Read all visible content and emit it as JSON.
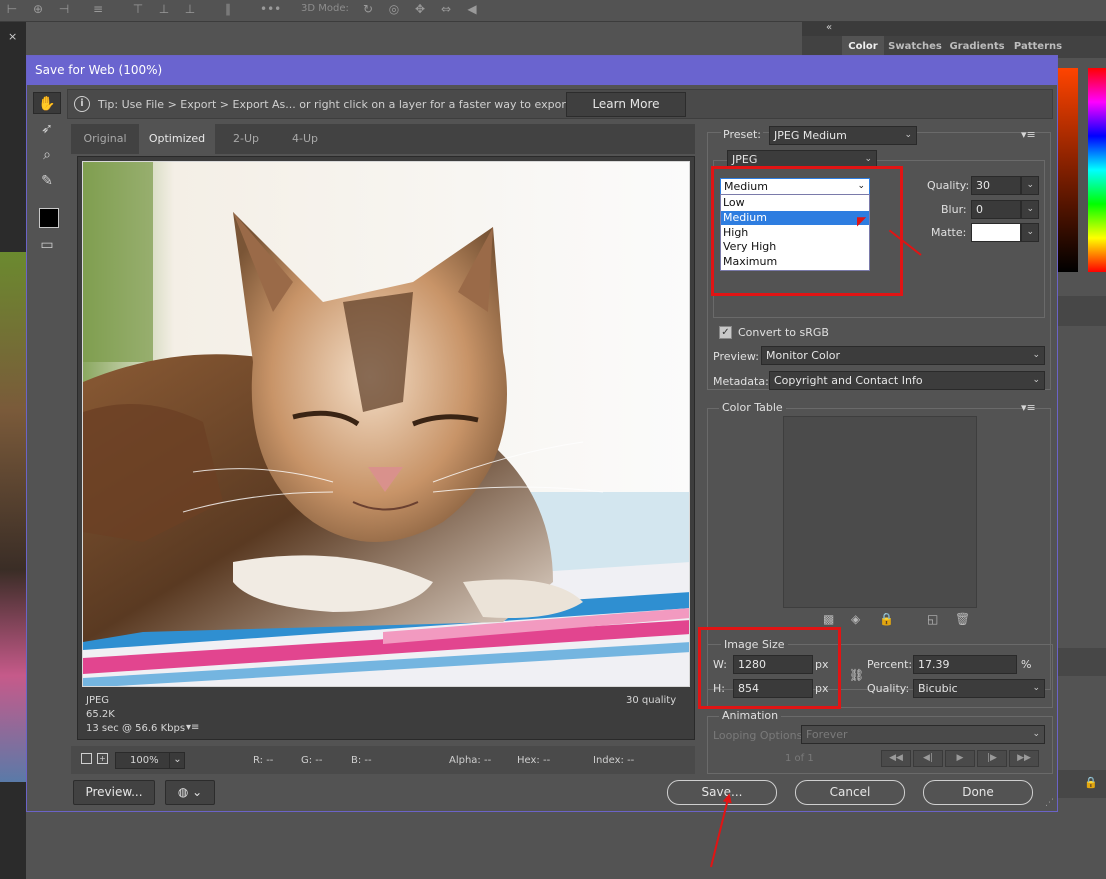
{
  "top_toolbar": {
    "mode_3d_label": "3D Mode:"
  },
  "right_panel": {
    "tabs": [
      "Color",
      "Swatches",
      "Gradients",
      "Patterns"
    ],
    "active_tab": "Color"
  },
  "dialog": {
    "title": "Save for Web (100%)",
    "tip": {
      "text": "Tip: Use File > Export > Export As...  or right click on a layer for a faster way to export assets",
      "learn_more": "Learn More"
    },
    "view_tabs": [
      "Original",
      "Optimized",
      "2-Up",
      "4-Up"
    ],
    "active_view_tab": "Optimized",
    "preview_caption": {
      "format": "JPEG",
      "size": "65.2K",
      "time": "13 sec @ 56.6 Kbps",
      "quality": "30 quality"
    },
    "status_bar": {
      "zoom": "100%",
      "r": "R: --",
      "g": "G: --",
      "b": "B: --",
      "alpha": "Alpha: --",
      "hex": "Hex: --",
      "index": "Index: --"
    },
    "buttons": {
      "preview": "Preview...",
      "save": "Save...",
      "cancel": "Cancel",
      "done": "Done"
    },
    "settings": {
      "preset_label": "Preset:",
      "preset_value": "JPEG Medium",
      "format_value": "JPEG",
      "quality_level": "Medium",
      "quality_options": [
        "Low",
        "Medium",
        "High",
        "Very High",
        "Maximum"
      ],
      "highlighted_option": "Medium",
      "quality_label": "Quality:",
      "quality_value": "30",
      "blur_label": "Blur:",
      "blur_value": "0",
      "matte_label": "Matte:",
      "convert_srgb_label": "Convert to sRGB",
      "convert_srgb_checked": true,
      "preview_label": "Preview:",
      "preview_value": "Monitor Color",
      "metadata_label": "Metadata:",
      "metadata_value": "Copyright and Contact Info"
    },
    "color_table": {
      "title": "Color Table"
    },
    "image_size": {
      "title": "Image Size",
      "w_label": "W:",
      "w_value": "1280",
      "h_label": "H:",
      "h_value": "854",
      "unit": "px",
      "percent_label": "Percent:",
      "percent_value": "17.39",
      "percent_unit": "%",
      "quality_label": "Quality:",
      "quality_value": "Bicubic"
    },
    "animation": {
      "title": "Animation",
      "looping_label": "Looping Options:",
      "looping_value": "Forever",
      "frame_counter": "1 of 1"
    }
  },
  "colors": {
    "dialog_title": "#6a64cf",
    "highlight": "#2e7de0",
    "annotation_red": "#e11414"
  }
}
